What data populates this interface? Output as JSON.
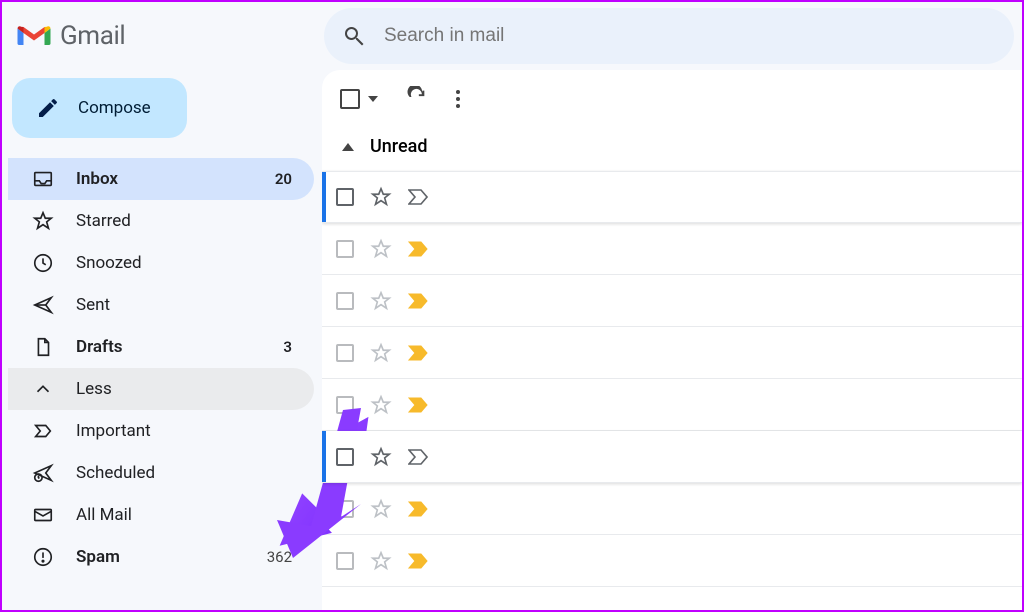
{
  "app": {
    "title": "Gmail"
  },
  "search": {
    "placeholder": "Search in mail"
  },
  "compose": {
    "label": "Compose"
  },
  "sidebar": {
    "items": [
      {
        "label": "Inbox",
        "count": "20",
        "icon": "inbox",
        "active": true,
        "bold": true
      },
      {
        "label": "Starred",
        "count": "",
        "icon": "star"
      },
      {
        "label": "Snoozed",
        "count": "",
        "icon": "clock"
      },
      {
        "label": "Sent",
        "count": "",
        "icon": "send"
      },
      {
        "label": "Drafts",
        "count": "3",
        "icon": "file",
        "bold": true
      },
      {
        "label": "Less",
        "count": "",
        "icon": "chev-up",
        "hover": true
      },
      {
        "label": "Important",
        "count": "",
        "icon": "important"
      },
      {
        "label": "Scheduled",
        "count": "",
        "icon": "scheduled"
      },
      {
        "label": "All Mail",
        "count": "",
        "icon": "mail"
      },
      {
        "label": "Spam",
        "count": "362",
        "icon": "spam",
        "bold": true,
        "lightcount": true
      }
    ]
  },
  "section": {
    "label": "Unread"
  },
  "rows": [
    {
      "selected": true,
      "important": "gray"
    },
    {
      "selected": false,
      "important": "gold"
    },
    {
      "selected": false,
      "important": "gold"
    },
    {
      "selected": false,
      "important": "gold"
    },
    {
      "selected": false,
      "important": "gold"
    },
    {
      "selected": true,
      "important": "gray"
    },
    {
      "selected": false,
      "important": "gold"
    },
    {
      "selected": false,
      "important": "gold"
    }
  ]
}
